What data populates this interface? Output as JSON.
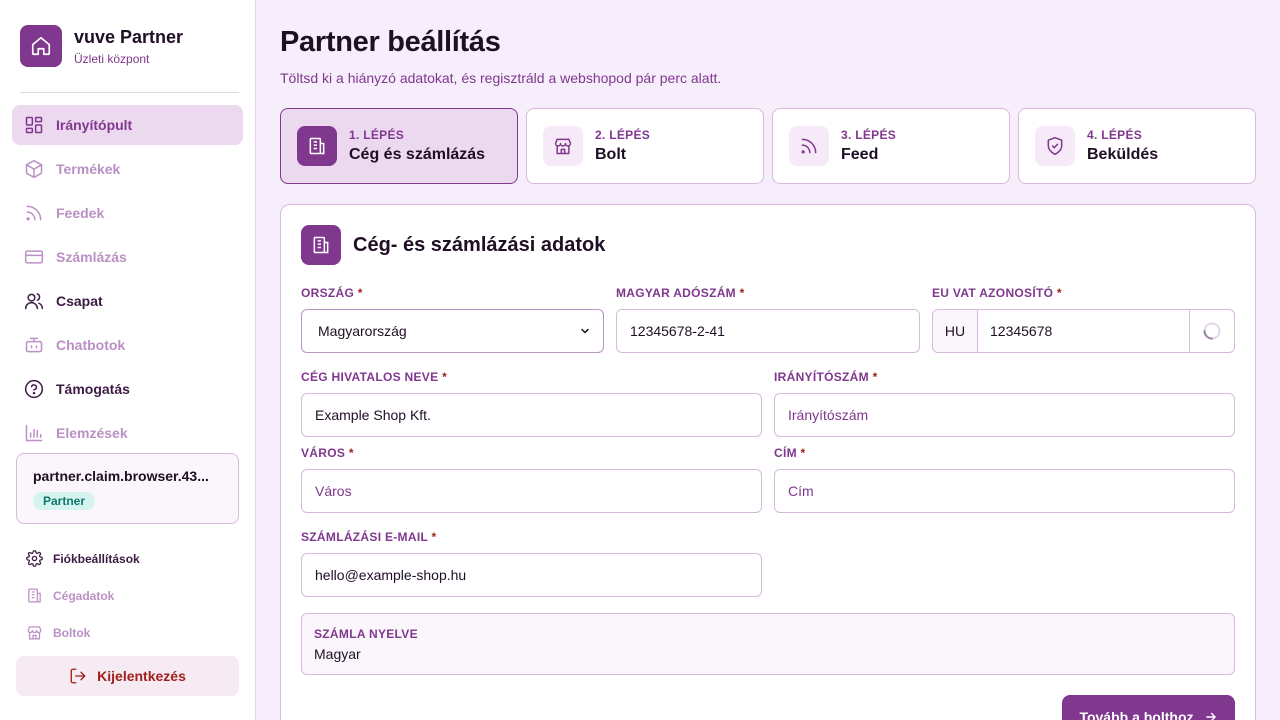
{
  "brand": {
    "title": "vuve Partner",
    "subtitle": "Üzleti központ"
  },
  "sidebar": {
    "items": [
      {
        "label": "Irányítópult",
        "icon": "dashboard-icon"
      },
      {
        "label": "Termékek",
        "icon": "box-icon"
      },
      {
        "label": "Feedek",
        "icon": "rss-icon"
      },
      {
        "label": "Számlázás",
        "icon": "credit-card-icon"
      },
      {
        "label": "Csapat",
        "icon": "users-icon"
      },
      {
        "label": "Chatbotok",
        "icon": "bot-icon"
      },
      {
        "label": "Támogatás",
        "icon": "help-circle-icon"
      },
      {
        "label": "Elemzések",
        "icon": "bar-chart-icon"
      }
    ],
    "active_index": 0
  },
  "user": {
    "name": "partner.claim.browser.43...",
    "role": "Partner"
  },
  "sub_nav": [
    {
      "label": "Fiókbeállítások",
      "icon": "gear-icon"
    },
    {
      "label": "Cégadatok",
      "icon": "building-icon"
    },
    {
      "label": "Boltok",
      "icon": "store-icon"
    }
  ],
  "logout_label": "Kijelentkezés",
  "page": {
    "title": "Partner beállítás",
    "subtitle": "Töltsd ki a hiányzó adatokat, és regisztráld a webshopod pár perc alatt."
  },
  "steps": [
    {
      "num": "1. LÉPÉS",
      "title": "Cég és számlázás",
      "icon": "building-icon"
    },
    {
      "num": "2. LÉPÉS",
      "title": "Bolt",
      "icon": "store-icon"
    },
    {
      "num": "3. LÉPÉS",
      "title": "Feed",
      "icon": "rss-icon"
    },
    {
      "num": "4. LÉPÉS",
      "title": "Beküldés",
      "icon": "shield-check-icon"
    }
  ],
  "form": {
    "title": "Cég- és számlázási adatok",
    "required_mark": "*",
    "country": {
      "label": "ORSZÁG",
      "value": "Magyarország"
    },
    "tax_number": {
      "label": "MAGYAR ADÓSZÁM",
      "value": "12345678-2-41"
    },
    "eu_vat": {
      "label": "EU VAT AZONOSÍTÓ",
      "prefix": "HU",
      "value": "12345678"
    },
    "company_name": {
      "label": "CÉG HIVATALOS NEVE",
      "value": "Example Shop Kft."
    },
    "zip": {
      "label": "IRÁNYÍTÓSZÁM",
      "placeholder": "Irányítószám"
    },
    "city": {
      "label": "VÁROS",
      "placeholder": "Város"
    },
    "address": {
      "label": "CÍM",
      "placeholder": "Cím"
    },
    "billing_email": {
      "label": "SZÁMLÁZÁSI E-MAIL",
      "value": "hello@example-shop.hu"
    },
    "invoice_language": {
      "label": "SZÁMLA NYELVE",
      "value": "Magyar"
    }
  },
  "next_button": "Tovább a bolthoz",
  "colors": {
    "accent": "#80388f",
    "danger": "#a0211b",
    "badge": "#0f766e"
  }
}
